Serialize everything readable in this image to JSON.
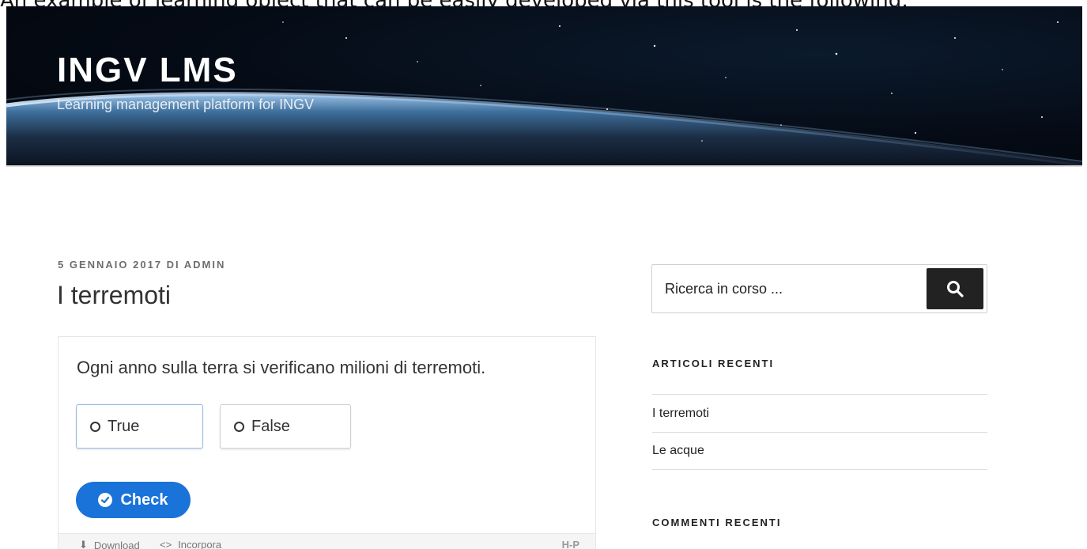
{
  "caption": "An example of learning object that can be easily developed via this tool is the following:",
  "site": {
    "title": "INGV LMS",
    "description": "Learning management platform for INGV"
  },
  "post": {
    "meta": "5 GENNAIO 2017 DI ADMIN",
    "title": "I terremoti"
  },
  "h5p": {
    "question": "Ogni anno sulla terra si verificano milioni di terremoti.",
    "option_true": "True",
    "option_false": "False",
    "check_label": "Check",
    "footer": {
      "download": "Download",
      "embed": "Incorpora",
      "logo": "H-P"
    }
  },
  "sidebar": {
    "search_placeholder": "Ricerca in corso ...",
    "recent_posts_title": "ARTICOLI RECENTI",
    "recent_posts": [
      "I terremoti",
      "Le acque"
    ],
    "recent_comments_title": "COMMENTI RECENTI"
  },
  "icons": {
    "search": "search-icon",
    "check": "check-circle-icon",
    "download": "download-icon",
    "embed": "embed-icon"
  },
  "colors": {
    "accent": "#1a73d9",
    "search_button": "#222222"
  }
}
